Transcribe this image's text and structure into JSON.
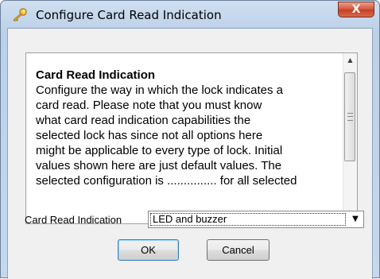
{
  "window": {
    "title": "Configure Card Read Indication",
    "close_glyph": "X",
    "icon": "key-icon"
  },
  "description": {
    "heading": "Card Read Indication",
    "lines": [
      "Configure the way in which the lock indicates a",
      "card read. Please note that you must know",
      "what card read indication capabilities the",
      "selected lock has since not all options here",
      "might be applicable to every type of lock. Initial",
      "values shown here are just default values. The",
      "selected configuration is ............... for all selected"
    ]
  },
  "setting": {
    "label": "Card Read Indication",
    "value": "LED and buzzer"
  },
  "buttons": {
    "ok": "OK",
    "cancel": "Cancel"
  }
}
